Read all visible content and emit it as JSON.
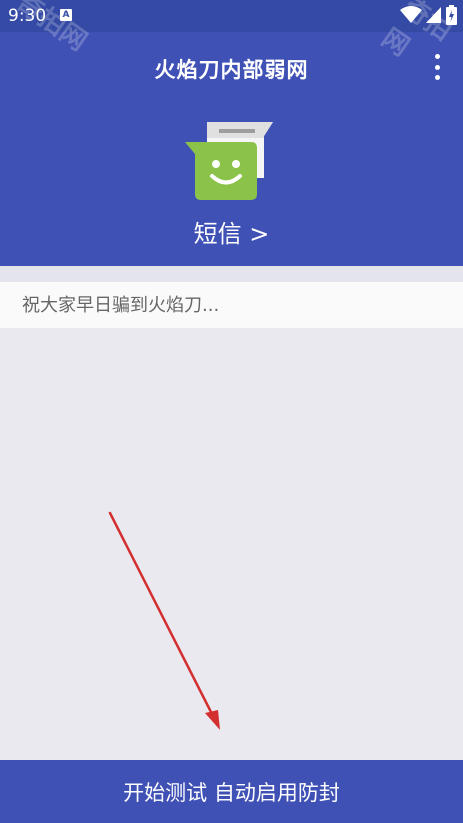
{
  "status_bar": {
    "time": "9:30",
    "notification_letter": "A"
  },
  "app": {
    "title": "火焰刀内部弱网",
    "menu_icon": "more-vert-icon",
    "sms_label": "短信 >"
  },
  "message": {
    "placeholder": "祝大家早日骗到火焰刀..."
  },
  "action": {
    "label": "开始测试 自动启用防封"
  },
  "colors": {
    "primary": "#3f51b5",
    "status_bar": "#344aa5",
    "background": "#e9e9ef",
    "sms_green": "#8bc34a",
    "annotation_arrow": "#d32f2f"
  }
}
